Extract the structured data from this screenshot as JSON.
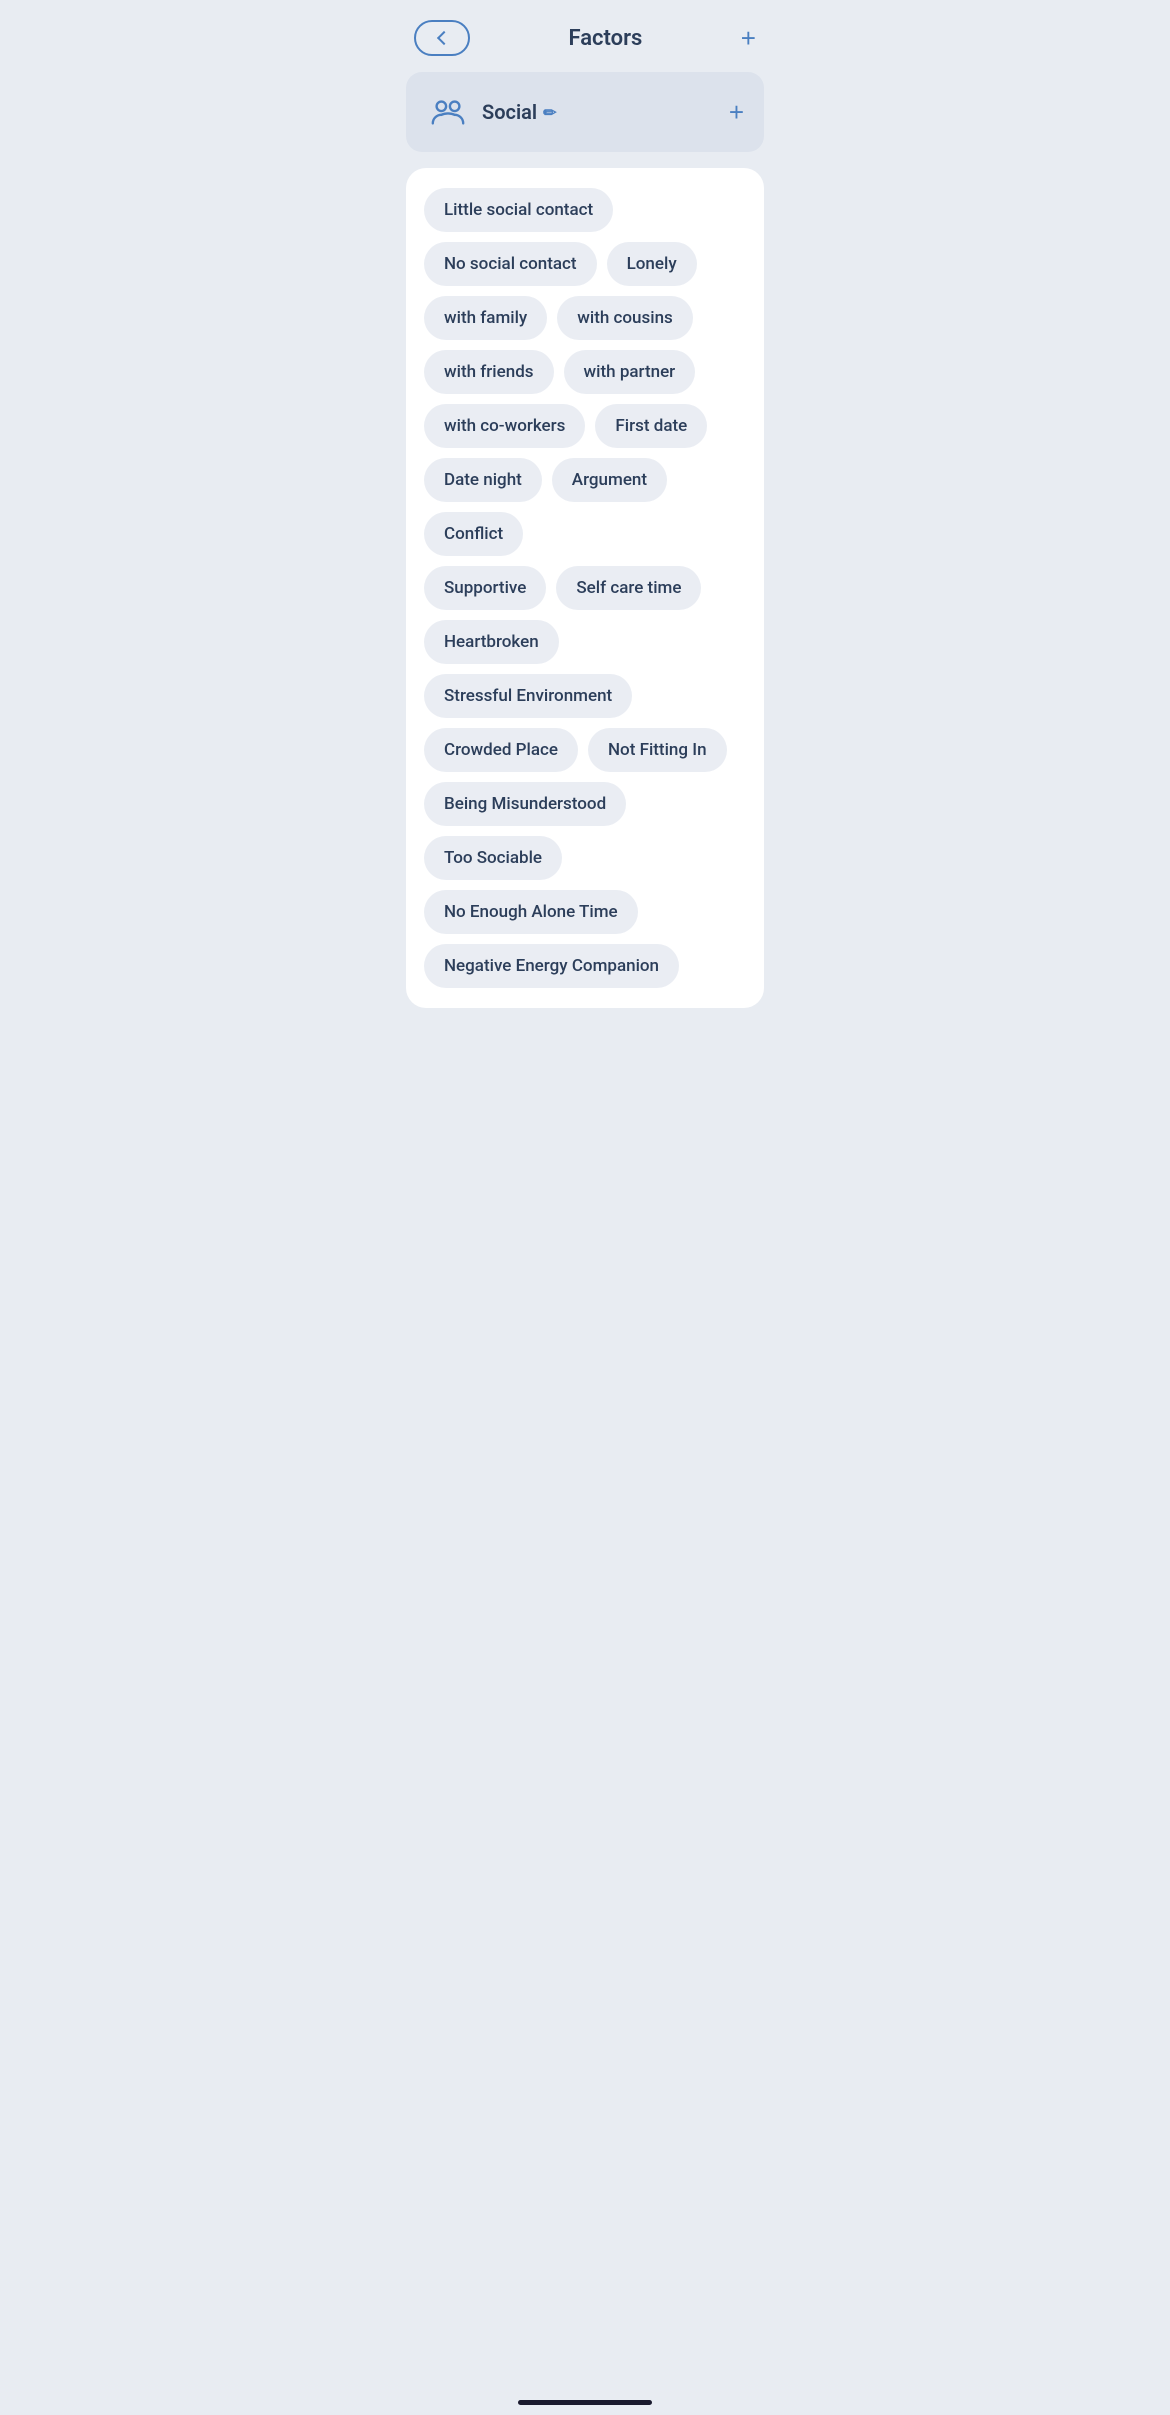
{
  "header": {
    "title": "Factors",
    "add_label": "+",
    "back_aria": "Back"
  },
  "category": {
    "name": "Social",
    "edit_icon": "✏",
    "add_label": "+"
  },
  "tags": [
    [
      "Little social contact"
    ],
    [
      "No social contact",
      "Lonely"
    ],
    [
      "with family",
      "with cousins"
    ],
    [
      "with friends",
      "with partner"
    ],
    [
      "with co-workers",
      "First date"
    ],
    [
      "Date night",
      "Argument",
      "Conflict"
    ],
    [
      "Supportive",
      "Self care time"
    ],
    [
      "Heartbroken",
      "Stressful Environment"
    ],
    [
      "Crowded Place",
      "Not Fitting In"
    ],
    [
      "Being Misunderstood",
      "Too Sociable"
    ],
    [
      "No Enough Alone Time"
    ],
    [
      "Negative Energy Companion"
    ]
  ]
}
